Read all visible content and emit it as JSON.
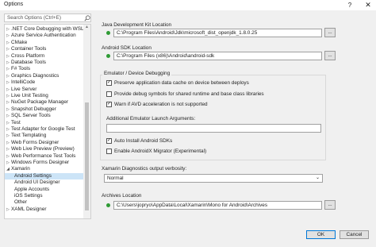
{
  "window": {
    "title": "Options",
    "help": "?",
    "close": "✕"
  },
  "search": {
    "placeholder": "Search Options (Ctrl+E)"
  },
  "tree": [
    {
      "label": ".NET Core Debugging with WSL",
      "arrow": "▷",
      "child": false
    },
    {
      "label": "Azure Service Authentication",
      "arrow": "▷",
      "child": false
    },
    {
      "label": "CMake",
      "arrow": "▷",
      "child": false
    },
    {
      "label": "Container Tools",
      "arrow": "▷",
      "child": false
    },
    {
      "label": "Cross Platform",
      "arrow": "▷",
      "child": false
    },
    {
      "label": "Database Tools",
      "arrow": "▷",
      "child": false
    },
    {
      "label": "F# Tools",
      "arrow": "▷",
      "child": false
    },
    {
      "label": "Graphics Diagnostics",
      "arrow": "▷",
      "child": false
    },
    {
      "label": "IntelliCode",
      "arrow": "▷",
      "child": false
    },
    {
      "label": "Live Server",
      "arrow": "▷",
      "child": false
    },
    {
      "label": "Live Unit Testing",
      "arrow": "▷",
      "child": false
    },
    {
      "label": "NuGet Package Manager",
      "arrow": "▷",
      "child": false
    },
    {
      "label": "Snapshot Debugger",
      "arrow": "▷",
      "child": false
    },
    {
      "label": "SQL Server Tools",
      "arrow": "▷",
      "child": false
    },
    {
      "label": "Test",
      "arrow": "▷",
      "child": false
    },
    {
      "label": "Test Adapter for Google Test",
      "arrow": "▷",
      "child": false
    },
    {
      "label": "Text Templating",
      "arrow": "▷",
      "child": false
    },
    {
      "label": "Web Forms Designer",
      "arrow": "▷",
      "child": false
    },
    {
      "label": "Web Live Preview (Preview)",
      "arrow": "▷",
      "child": false
    },
    {
      "label": "Web Performance Test Tools",
      "arrow": "▷",
      "child": false
    },
    {
      "label": "Windows Forms Designer",
      "arrow": "▷",
      "child": false
    },
    {
      "label": "Xamarin",
      "arrow": "◢",
      "child": false
    },
    {
      "label": "Android Settings",
      "arrow": "",
      "child": true,
      "selected": true
    },
    {
      "label": "Android UI Designer",
      "arrow": "",
      "child": true
    },
    {
      "label": "Apple Accounts",
      "arrow": "",
      "child": true
    },
    {
      "label": "iOS Settings",
      "arrow": "",
      "child": true
    },
    {
      "label": "Other",
      "arrow": "",
      "child": true
    },
    {
      "label": "XAML Designer",
      "arrow": "▷",
      "child": false
    }
  ],
  "jdk": {
    "label": "Java Development Kit Location",
    "path": "C:\\Program Files\\Android\\Jdk\\microsoft_dist_openjdk_1.8.0.25",
    "browse": "..."
  },
  "sdk": {
    "label": "Android SDK Location",
    "path": "C:\\Program Files (x86)\\Android\\android-sdk",
    "browse": "..."
  },
  "emulator": {
    "title": "Emulator / Device Debugging",
    "options": [
      {
        "label": "Preserve application data cache on device between deploys",
        "checked": "✓"
      },
      {
        "label": "Provide debug symbols for shared runtime and base class libraries",
        "checked": ""
      },
      {
        "label": "Warn if AVD acceleration is not supported",
        "checked": "✓"
      }
    ],
    "args_label": "Additional Emulator Launch Arguments:",
    "args_value": "",
    "auto_install": {
      "label": "Auto Install Android SDKs",
      "checked": "✓"
    },
    "migrator": {
      "label": "Enable AndroidX Migrator (Experimental)",
      "checked": ""
    }
  },
  "verbosity": {
    "label": "Xamarin Diagnostics output verbosity:",
    "value": "Normal",
    "chevron": "⌄"
  },
  "archives": {
    "label": "Archives Location",
    "path": "C:\\Users\\jopryo\\AppData\\Local\\Xamarin\\Mono for Android\\Archives",
    "browse": "..."
  },
  "buttons": {
    "ok": "OK",
    "cancel": "Cancel"
  }
}
